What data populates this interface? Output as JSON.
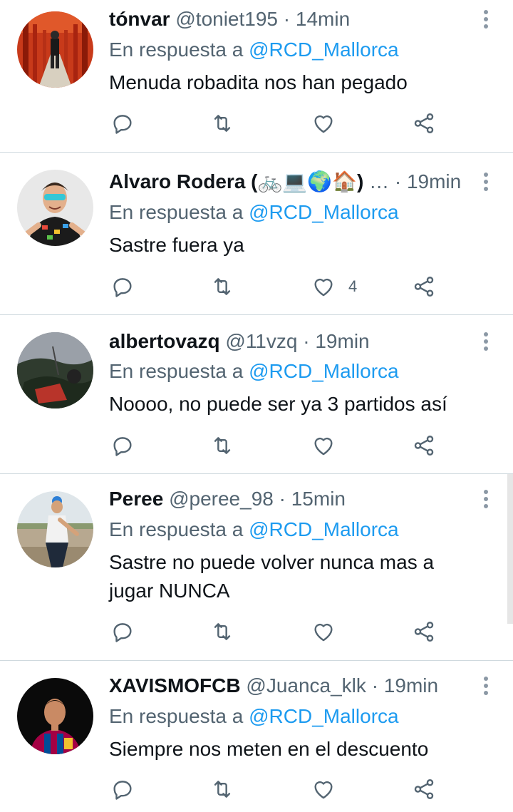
{
  "tweets": [
    {
      "name": "tónvar",
      "handle": "@toniet195",
      "sep": "·",
      "time": "14min",
      "reply_prefix": "En respuesta a",
      "reply_to": "@RCD_Mallorca",
      "text": "Menuda robadita nos han pegado",
      "likes": ""
    },
    {
      "name": "Alvaro Rodera (🚲💻🌍🏠)",
      "handle": "…",
      "sep": "·",
      "time": "19min",
      "reply_prefix": "En respuesta a",
      "reply_to": "@RCD_Mallorca",
      "text": "Sastre fuera ya",
      "likes": "4"
    },
    {
      "name": "albertovazq",
      "handle": "@11vzq",
      "sep": "·",
      "time": "19min",
      "reply_prefix": "En respuesta a",
      "reply_to": "@RCD_Mallorca",
      "text": "Noooo, no puede ser ya 3 partidos así",
      "likes": ""
    },
    {
      "name": "Peree",
      "handle": "@peree_98",
      "sep": "·",
      "time": "15min",
      "reply_prefix": "En respuesta a",
      "reply_to": "@RCD_Mallorca",
      "text": "Sastre no puede volver nunca mas a jugar NUNCA",
      "likes": ""
    },
    {
      "name": "XAVISMOFCB",
      "handle": "@Juanca_klk",
      "sep": "·",
      "time": "19min",
      "reply_prefix": "En respuesta a",
      "reply_to": "@RCD_Mallorca",
      "text": "Siempre nos meten en el descuento",
      "likes": ""
    }
  ],
  "icons": {
    "reply": "reply-icon",
    "retweet": "retweet-icon",
    "like": "heart-icon",
    "share": "share-icon",
    "more": "more-vertical-icon"
  },
  "colors": {
    "link": "#1d9bf0",
    "secondary_text": "#536471",
    "divider": "#cfd9de",
    "icon": "#536471"
  }
}
